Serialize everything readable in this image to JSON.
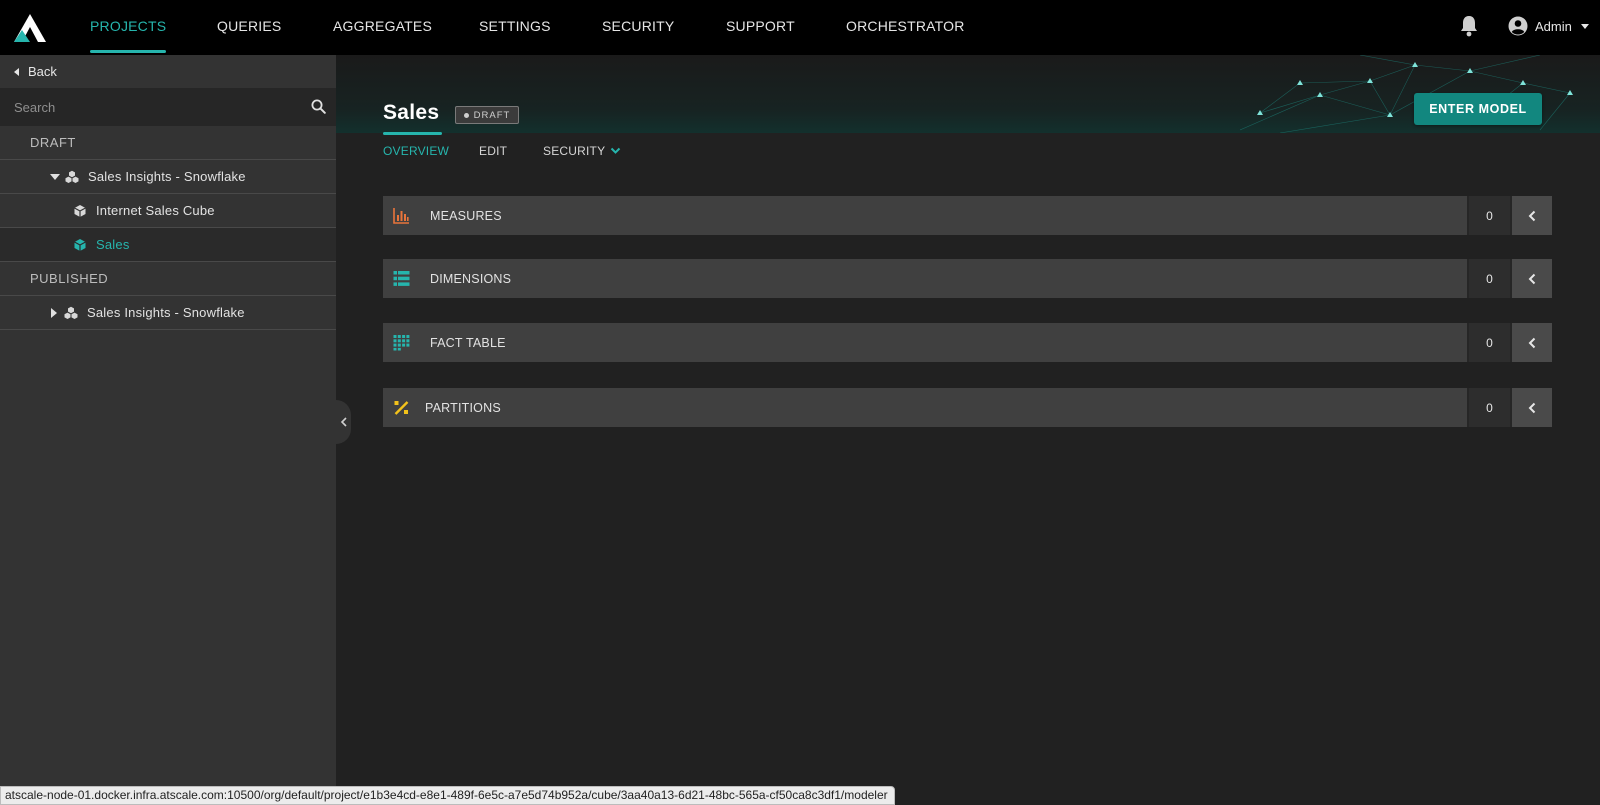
{
  "nav": {
    "items": [
      {
        "label": "PROJECTS",
        "active": true
      },
      {
        "label": "QUERIES",
        "active": false
      },
      {
        "label": "AGGREGATES",
        "active": false
      },
      {
        "label": "SETTINGS",
        "active": false
      },
      {
        "label": "SECURITY",
        "active": false
      },
      {
        "label": "SUPPORT",
        "active": false
      },
      {
        "label": "ORCHESTRATOR",
        "active": false
      }
    ],
    "user_label": "Admin",
    "icons": {
      "logo": "atscale-logo",
      "notifications": "bell-icon",
      "user": "user-circle-icon"
    }
  },
  "sidebar": {
    "back_label": "Back",
    "search_placeholder": "Search",
    "sections": [
      {
        "title": "DRAFT",
        "items": [
          {
            "label": "Sales Insights - Snowflake",
            "level": 1,
            "expanded": true,
            "icon": "cubes-icon"
          },
          {
            "label": "Internet Sales Cube",
            "level": 2,
            "icon": "cube-icon"
          },
          {
            "label": "Sales",
            "level": 2,
            "icon": "cube-icon",
            "selected": true
          }
        ]
      },
      {
        "title": "PUBLISHED",
        "items": [
          {
            "label": "Sales Insights - Snowflake",
            "level": 1,
            "expanded": false,
            "icon": "cubes-icon"
          }
        ]
      }
    ]
  },
  "header": {
    "title": "Sales",
    "badge": "DRAFT",
    "enter_button": "ENTER MODEL"
  },
  "subtabs": [
    {
      "label": "OVERVIEW",
      "active": true
    },
    {
      "label": "EDIT",
      "active": false
    },
    {
      "label": "SECURITY",
      "active": false,
      "has_dropdown": true
    }
  ],
  "panels": [
    {
      "label": "MEASURES",
      "count": "0",
      "icon": "bar-chart-icon",
      "icon_color": "#e8743b"
    },
    {
      "label": "DIMENSIONS",
      "count": "0",
      "icon": "list-icon",
      "icon_color": "#26b5ad"
    },
    {
      "label": "FACT TABLE",
      "count": "0",
      "icon": "grid-icon",
      "icon_color": "#26b5ad"
    },
    {
      "label": "PARTITIONS",
      "count": "0",
      "icon": "percent-icon",
      "icon_color": "#f2c21b"
    }
  ],
  "status_url": "atscale-node-01.docker.infra.atscale.com:10500/org/default/project/e1b3e4cd-e8e1-489f-6e5c-a7e5d74b952a/cube/3aa40a13-6d21-48bc-565a-cf50ca8c3df1/modeler",
  "colors": {
    "accent": "#26b5ad",
    "button": "#12877f",
    "background": "#212121",
    "sidebar": "#333333"
  }
}
